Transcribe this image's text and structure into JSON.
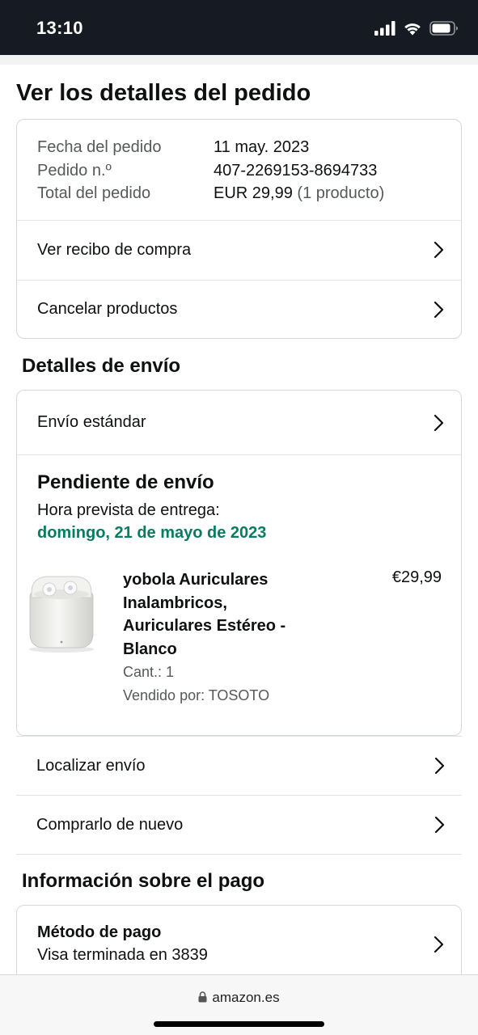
{
  "status_bar": {
    "time": "13:10"
  },
  "title": "Ver los detalles del pedido",
  "order_summary": {
    "date_label": "Fecha del pedido",
    "date_value": "11 may. 2023",
    "number_label": "Pedido n.º",
    "number_value": "407-2269153-8694733",
    "total_label": "Total del pedido",
    "total_value": "EUR 29,99",
    "total_count": "(1 producto)"
  },
  "actions": {
    "receipt": "Ver recibo de compra",
    "cancel": "Cancelar productos"
  },
  "shipping": {
    "section_title": "Detalles de envío",
    "method": "Envío estándar",
    "status_title": "Pendiente de envío",
    "eta_label": "Hora prevista de entrega:",
    "eta_date": "domingo, 21 de mayo de 2023"
  },
  "item": {
    "title": "yobola Auriculares Inalambricos, Auriculares Estéreo - Blanco",
    "price": "€29,99",
    "qty": "Cant.: 1",
    "seller": "Vendido por: TOSOTO"
  },
  "links": {
    "track": "Localizar envío",
    "buy_again": "Comprarlo de nuevo"
  },
  "payment": {
    "section_title": "Información sobre el pago",
    "method_title": "Método de pago",
    "method_value": "Visa terminada en 3839"
  },
  "browser": {
    "url": "amazon.es"
  },
  "colors": {
    "delivery_green": "#067d62",
    "status_bar": "#151a23"
  }
}
